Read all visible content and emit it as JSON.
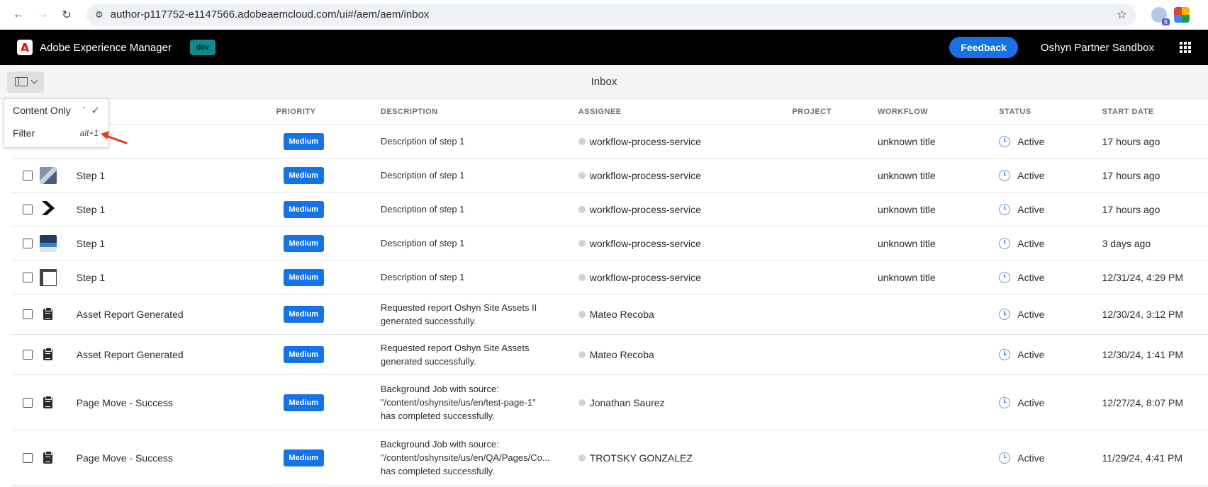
{
  "browser": {
    "url": "author-p117752-e1147566.adobeaemcloud.com/ui#/aem/aem/inbox",
    "extension_badge_count": "6"
  },
  "shell": {
    "app_name": "Adobe Experience Manager",
    "env_badge": "dev",
    "feedback_label": "Feedback",
    "org_name": "Oshyn Partner Sandbox"
  },
  "page": {
    "title": "Inbox"
  },
  "view_menu": {
    "items": [
      {
        "label": "Content Only",
        "shortcut": "`",
        "checked": true
      },
      {
        "label": "Filter",
        "shortcut": "alt+1",
        "checked": false
      }
    ]
  },
  "table": {
    "columns": [
      "PRIORITY",
      "DESCRIPTION",
      "ASSIGNEE",
      "PROJECT",
      "WORKFLOW",
      "STATUS",
      "START DATE"
    ],
    "rows": [
      {
        "thumb": "none",
        "title": "",
        "priority": "Medium",
        "description": [
          "Description of step 1"
        ],
        "assignee": "workflow-process-service",
        "project": "",
        "workflow": "unknown title",
        "status": "Active",
        "start_date": "17 hours ago"
      },
      {
        "thumb": "photo-people",
        "title": "Step 1",
        "priority": "Medium",
        "description": [
          "Description of step 1"
        ],
        "assignee": "workflow-process-service",
        "project": "",
        "workflow": "unknown title",
        "status": "Active",
        "start_date": "17 hours ago"
      },
      {
        "thumb": "chevron-logo",
        "title": "Step 1",
        "priority": "Medium",
        "description": [
          "Description of step 1"
        ],
        "assignee": "workflow-process-service",
        "project": "",
        "workflow": "unknown title",
        "status": "Active",
        "start_date": "17 hours ago"
      },
      {
        "thumb": "photo-screen",
        "title": "Step 1",
        "priority": "Medium",
        "description": [
          "Description of step 1"
        ],
        "assignee": "workflow-process-service",
        "project": "",
        "workflow": "unknown title",
        "status": "Active",
        "start_date": "3 days ago"
      },
      {
        "thumb": "page-layout",
        "title": "Step 1",
        "priority": "Medium",
        "description": [
          "Description of step 1"
        ],
        "assignee": "workflow-process-service",
        "project": "",
        "workflow": "unknown title",
        "status": "Active",
        "start_date": "12/31/24, 4:29 PM"
      },
      {
        "thumb": "clipboard-icon",
        "title": "Asset Report Generated",
        "priority": "Medium",
        "description": [
          "Requested report Oshyn Site Assets II",
          "generated successfully."
        ],
        "assignee": "Mateo Recoba",
        "project": "",
        "workflow": "",
        "status": "Active",
        "start_date": "12/30/24, 3:12 PM"
      },
      {
        "thumb": "clipboard-icon",
        "title": "Asset Report Generated",
        "priority": "Medium",
        "description": [
          "Requested report Oshyn Site Assets",
          "generated successfully."
        ],
        "assignee": "Mateo Recoba",
        "project": "",
        "workflow": "",
        "status": "Active",
        "start_date": "12/30/24, 1:41 PM"
      },
      {
        "thumb": "clipboard-icon",
        "title": "Page Move - Success",
        "priority": "Medium",
        "description": [
          "Background Job with source:",
          "\"/content/oshynsite/us/en/test-page-1\"",
          "has completed successfully."
        ],
        "assignee": "Jonathan Saurez",
        "project": "",
        "workflow": "",
        "status": "Active",
        "start_date": "12/27/24, 8:07 PM"
      },
      {
        "thumb": "clipboard-icon",
        "title": "Page Move - Success",
        "priority": "Medium",
        "description": [
          "Background Job with source:",
          "\"/content/oshynsite/us/en/QA/Pages/Co...",
          "has completed successfully."
        ],
        "assignee": "TROTSKY GONZALEZ",
        "project": "",
        "workflow": "",
        "status": "Active",
        "start_date": "11/29/24, 4:41 PM"
      }
    ]
  },
  "colors": {
    "accent": "#1473e6",
    "shell_bg": "#000000",
    "env_badge": "#13888a",
    "annotation_arrow": "#e5391f"
  }
}
